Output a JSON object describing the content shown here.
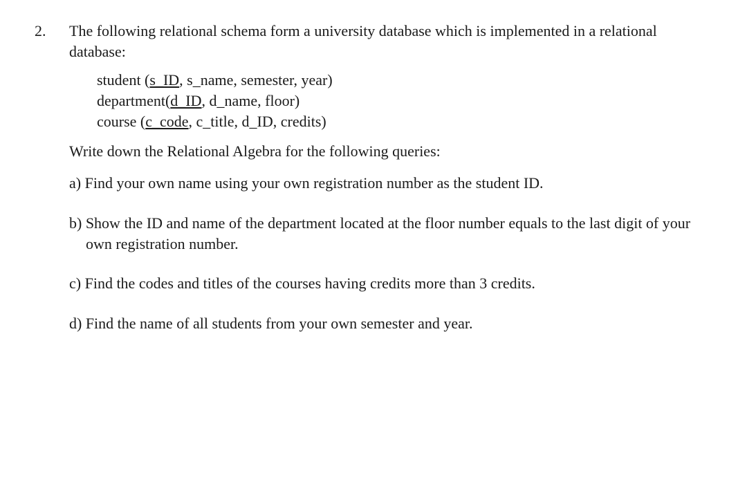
{
  "question": {
    "number": "2.",
    "intro": "The following relational schema form a university database which is implemented in a relational database:",
    "schema": {
      "student": {
        "relation": "student (",
        "key": "s_ID",
        "rest": ", s_name, semester, year)"
      },
      "department": {
        "relation": "department(",
        "key": "d_ID",
        "rest": ", d_name, floor)"
      },
      "course": {
        "relation": "course (",
        "key": "c_code",
        "rest": ", c_title, d_ID, credits)"
      }
    },
    "instruction": "Write down the Relational Algebra for the following queries:",
    "queries": {
      "a": "a) Find your own name using your own registration number as the student ID.",
      "b": "b) Show the ID and name of the department located at the floor number equals to the last digit of your own registration number.",
      "c": "c) Find the codes and titles of the courses having credits more than 3 credits.",
      "d": "d) Find the name of all students from your own semester and year."
    }
  }
}
